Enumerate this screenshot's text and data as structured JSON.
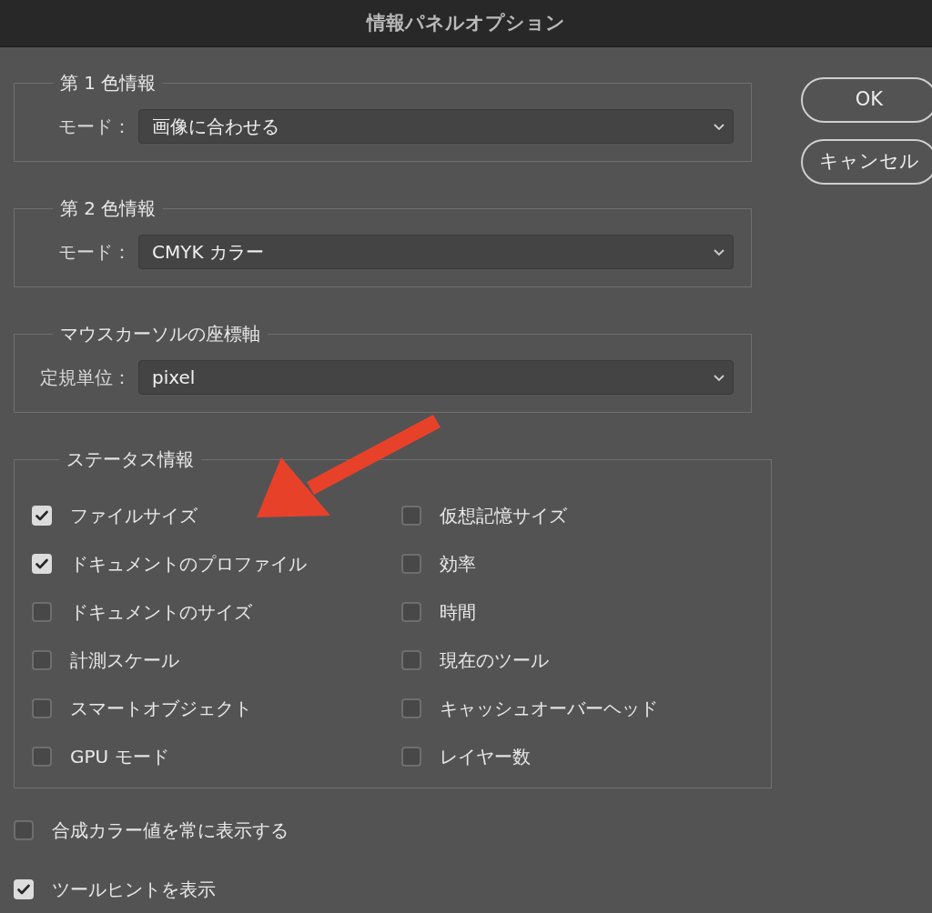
{
  "window": {
    "title": "情報パネルオプション"
  },
  "sections": [
    {
      "kind": "select",
      "legend": "第 1 色情報",
      "label": "モード：",
      "value": "画像に合わせる"
    },
    {
      "kind": "select",
      "legend": "第 2 色情報",
      "label": "モード：",
      "value": "CMYK カラー"
    },
    {
      "kind": "select",
      "legend": "マウスカーソルの座標軸",
      "label": "定規単位：",
      "value": "pixel"
    },
    {
      "kind": "checkboxes",
      "legend": "ステータス情報",
      "columns": [
        [
          {
            "label": "ファイルサイズ",
            "checked": true
          },
          {
            "label": "ドキュメントのプロファイル",
            "checked": true
          },
          {
            "label": "ドキュメントのサイズ",
            "checked": false
          },
          {
            "label": "計測スケール",
            "checked": false
          },
          {
            "label": "スマートオブジェクト",
            "checked": false
          },
          {
            "label": "GPU モード",
            "checked": false
          }
        ],
        [
          {
            "label": "仮想記憶サイズ",
            "checked": false
          },
          {
            "label": "効率",
            "checked": false
          },
          {
            "label": "時間",
            "checked": false
          },
          {
            "label": "現在のツール",
            "checked": false
          },
          {
            "label": "キャッシュオーバーヘッド",
            "checked": false
          },
          {
            "label": "レイヤー数",
            "checked": false
          }
        ]
      ]
    }
  ],
  "options": [
    {
      "label": "合成カラー値を常に表示する",
      "checked": false
    },
    {
      "label": "ツールヒントを表示",
      "checked": true
    }
  ],
  "buttons": [
    {
      "label": "OK"
    },
    {
      "label": "キャンセル"
    }
  ]
}
